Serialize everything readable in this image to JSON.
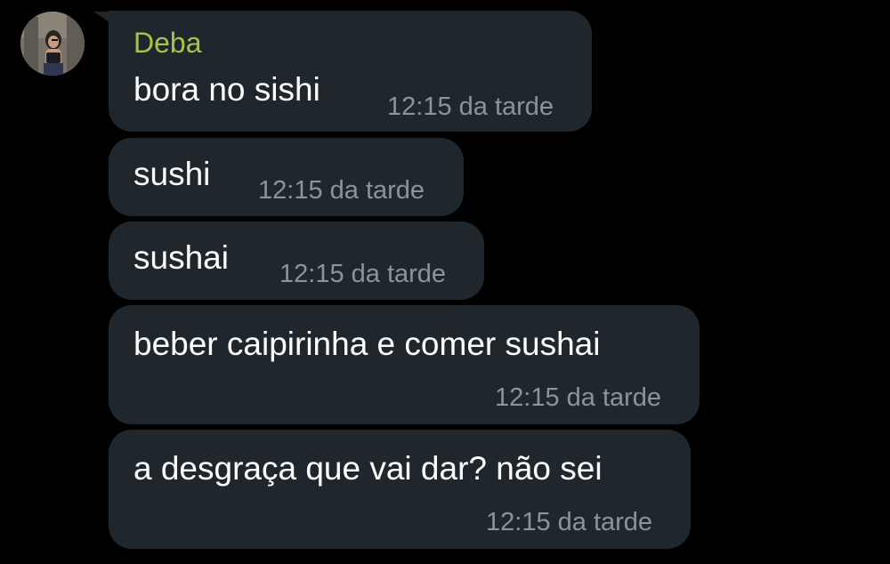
{
  "chat": {
    "sender_name": "Deba",
    "sender_color": "#a7c34a",
    "bubble_color": "#1f272d",
    "background_color": "#000000",
    "messages": [
      {
        "text": "bora no sishi",
        "time": "12:15 da tarde"
      },
      {
        "text": "sushi",
        "time": "12:15 da tarde"
      },
      {
        "text": "sushai",
        "time": "12:15 da tarde"
      },
      {
        "text": "beber caipirinha e comer sushai",
        "time": "12:15 da tarde"
      },
      {
        "text": "a desgraça que vai dar? não sei",
        "time": "12:15 da tarde"
      }
    ]
  }
}
